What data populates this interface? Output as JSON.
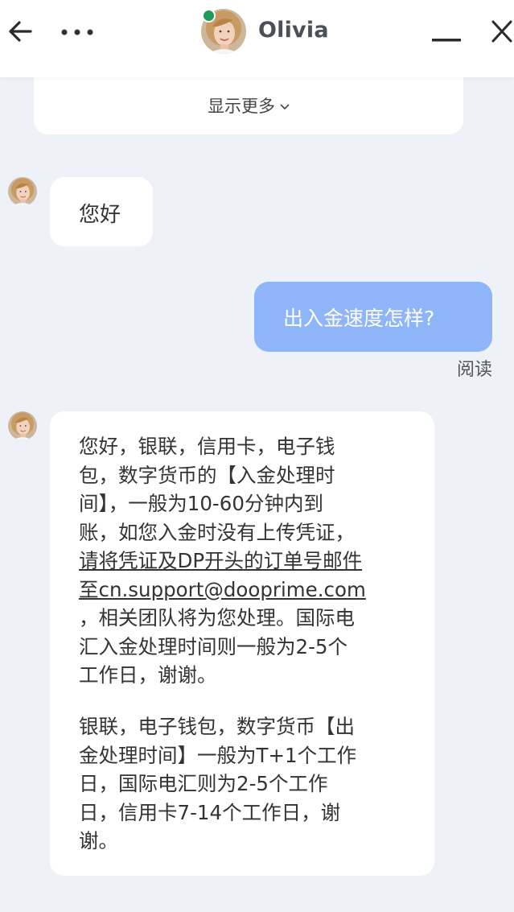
{
  "header": {
    "agent_name": "Olivia",
    "online_color": "#1f9a57",
    "icons": [
      "back-arrow-icon",
      "more-options-icon",
      "minimize-icon",
      "close-icon"
    ]
  },
  "history": {
    "show_more_label": "显示更多"
  },
  "messages": [
    {
      "from": "agent",
      "text": "您好"
    },
    {
      "from": "user",
      "text": "出入金速度怎样?",
      "status": "阅读"
    },
    {
      "from": "agent",
      "p1_lines": [
        "您好，银联，信用卡，电子钱",
        "包，数字货币的【入金处理时",
        "间】，一般为10-60分钟内到",
        "账，如您入金时没有上传凭证，"
      ],
      "p1_link": [
        "请将凭证及DP开头的订单号邮件",
        "至cn.support@dooprime.com"
      ],
      "p1_tail": [
        " ，相关团队将为您处理。国际电",
        "汇入金处理时间则一般为2-5个",
        "工作日，谢谢。"
      ],
      "p2_lines": [
        "银联，电子钱包，数字货币【出",
        "金处理时间】一般为T+1个工作",
        "日，国际电汇则为2-5个工作",
        "日，信用卡7-14个工作日，谢",
        "谢。"
      ]
    }
  ],
  "colors": {
    "user_bubble": "#8fb5f9",
    "agent_bubble": "#ffffff",
    "chat_bg": "#eef1f7"
  }
}
